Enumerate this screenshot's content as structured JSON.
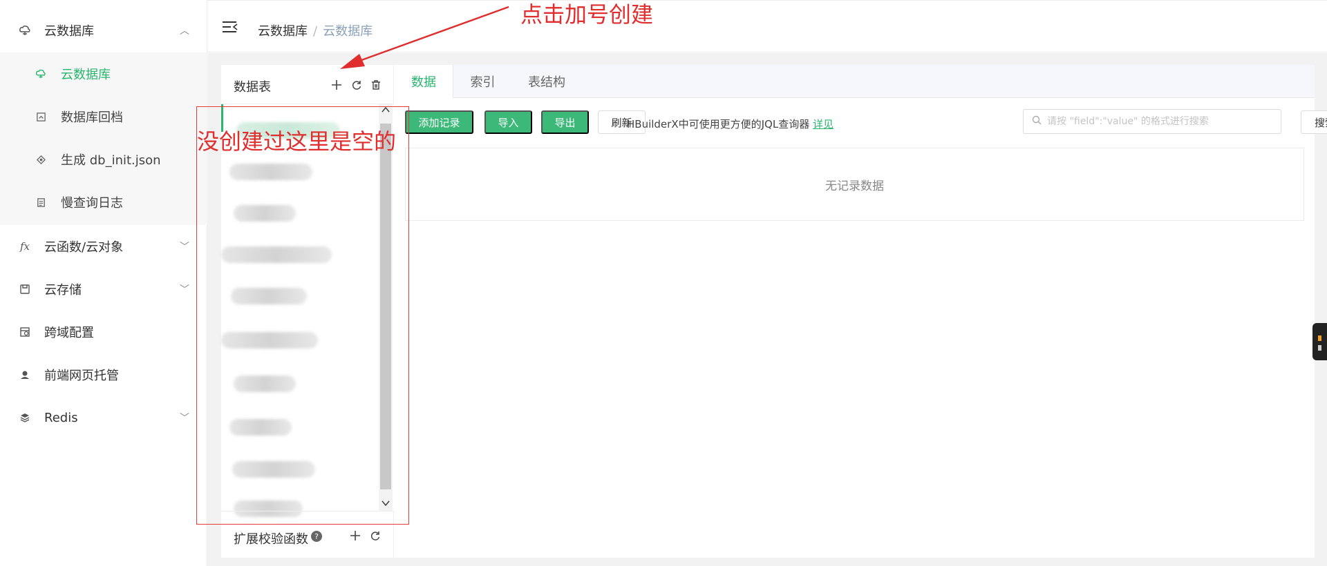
{
  "sidebar": {
    "items": [
      {
        "label": "云数据库",
        "icon": "cloud-db-icon"
      },
      {
        "label": "云函数/云对象",
        "icon": "fx-icon"
      },
      {
        "label": "云存储",
        "icon": "storage-icon"
      },
      {
        "label": "跨域配置",
        "icon": "cors-icon"
      },
      {
        "label": "前端网页托管",
        "icon": "hosting-icon"
      },
      {
        "label": "Redis",
        "icon": "redis-icon"
      }
    ],
    "sub_items": [
      {
        "label": "云数据库",
        "icon": "cloud-db-icon",
        "active": true
      },
      {
        "label": "数据库回档",
        "icon": "rollback-icon"
      },
      {
        "label": "生成 db_init.json",
        "icon": "generate-icon"
      },
      {
        "label": "慢查询日志",
        "icon": "log-icon"
      }
    ]
  },
  "breadcrumb": {
    "first": "云数据库",
    "separator": "/",
    "current": "云数据库"
  },
  "tables_panel": {
    "title": "数据表",
    "extension_label": "扩展校验函数",
    "help_glyph": "?"
  },
  "tabs": [
    {
      "label": "数据",
      "active": true
    },
    {
      "label": "索引"
    },
    {
      "label": "表结构"
    }
  ],
  "toolbar": {
    "add_record": "添加记录",
    "import": "导入",
    "export": "导出",
    "refresh": "刷新",
    "hint_text": "HBuilderX中可使用更方便的JQL查询器",
    "hint_link": "详见",
    "search_placeholder": "请按 \"field\":\"value\" 的格式进行搜索",
    "search_button": "搜索"
  },
  "table_body": {
    "empty_text": "无记录数据"
  },
  "annotations": {
    "top_note": "点击加号创建",
    "list_note": "没创建过这里是空的"
  },
  "colors": {
    "accent": "#28b56e",
    "annotation": "#e02d2d"
  }
}
